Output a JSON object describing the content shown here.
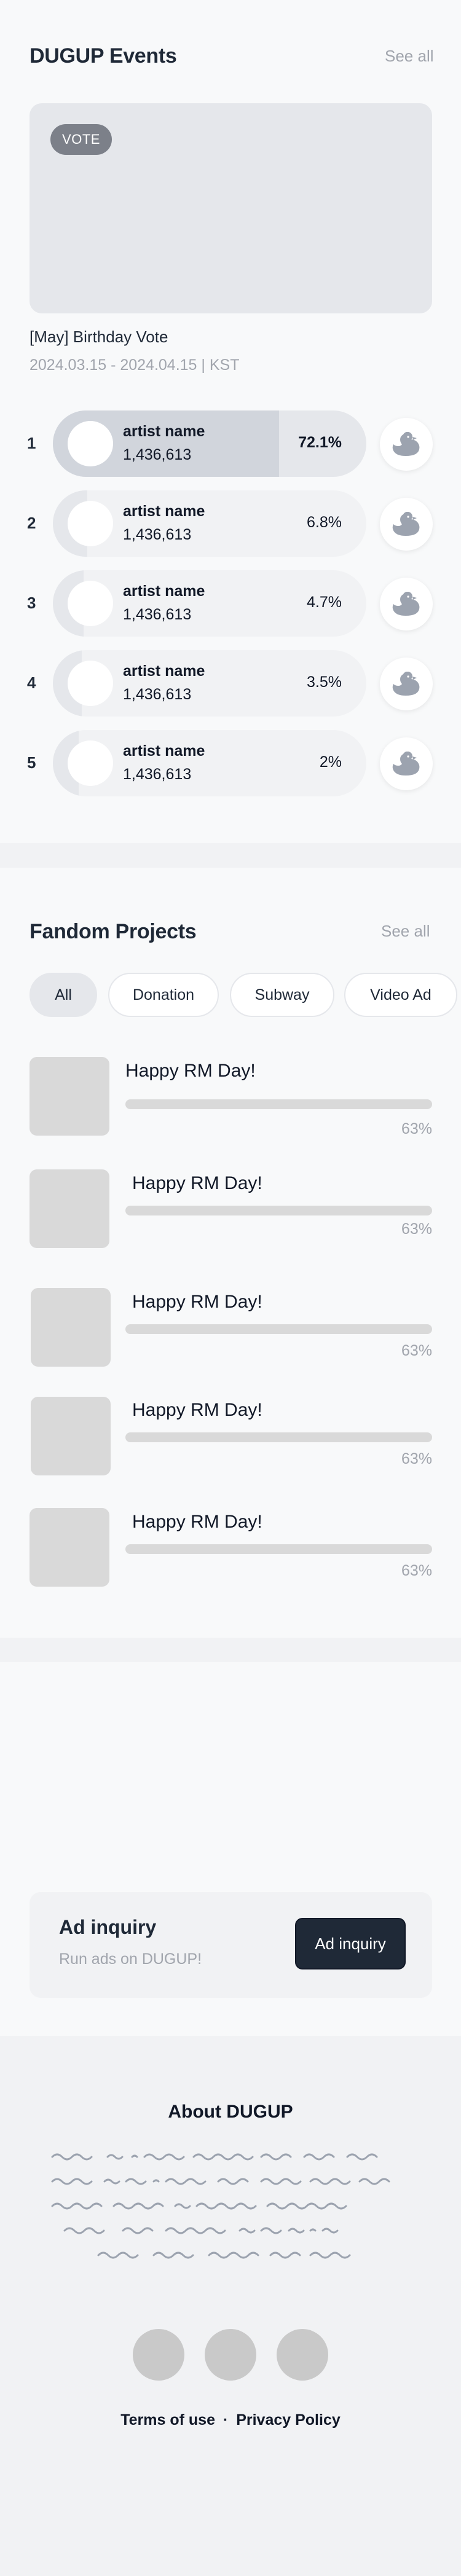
{
  "events": {
    "title": "DUGUP Events",
    "see_all": "See all",
    "vote_badge": "VOTE",
    "event_title": "[May] Birthday Vote",
    "event_dates": "2024.03.15 - 2024.04.15 | KST",
    "ranking": [
      {
        "rank": "1",
        "name": "artist name",
        "votes": "1,436,613",
        "percent": "72.1%",
        "share": 0.721
      },
      {
        "rank": "2",
        "name": "artist name",
        "votes": "1,436,613",
        "percent": "6.8%",
        "share": 0.068
      },
      {
        "rank": "3",
        "name": "artist name",
        "votes": "1,436,613",
        "percent": "4.7%",
        "share": 0.047
      },
      {
        "rank": "4",
        "name": "artist name",
        "votes": "1,436,613",
        "percent": "3.5%",
        "share": 0.035
      },
      {
        "rank": "5",
        "name": "artist name",
        "votes": "1,436,613",
        "percent": "2%",
        "share": 0.02
      }
    ],
    "vote_icon": "duck-icon"
  },
  "fandom": {
    "title": "Fandom Projects",
    "see_all": "See all",
    "filters": [
      {
        "label": "All",
        "active": true
      },
      {
        "label": "Donation",
        "active": false
      },
      {
        "label": "Subway",
        "active": false
      },
      {
        "label": "Video Ad",
        "active": false
      }
    ],
    "projects": [
      {
        "title": "Happy RM Day!",
        "percent": "63%",
        "progress": 0.63
      },
      {
        "title": "Happy RM Day!",
        "percent": "63%",
        "progress": 0.63
      },
      {
        "title": "Happy RM Day!",
        "percent": "63%",
        "progress": 0.63
      },
      {
        "title": "Happy RM Day!",
        "percent": "63%",
        "progress": 0.63
      },
      {
        "title": "Happy RM Day!",
        "percent": "63%",
        "progress": 0.63
      }
    ]
  },
  "ad": {
    "title": "Ad inquiry",
    "subtitle": "Run ads on DUGUP!",
    "button": "Ad inquiry"
  },
  "footer": {
    "about_title": "About DUGUP",
    "terms": "Terms of use",
    "separator": "·",
    "privacy": "Privacy Policy"
  },
  "colors": {
    "primary_dark": "#1f2937",
    "muted_text": "#a1a5ad",
    "badge_gray": "#7c8089",
    "duck_icon": "#9ca3af"
  }
}
